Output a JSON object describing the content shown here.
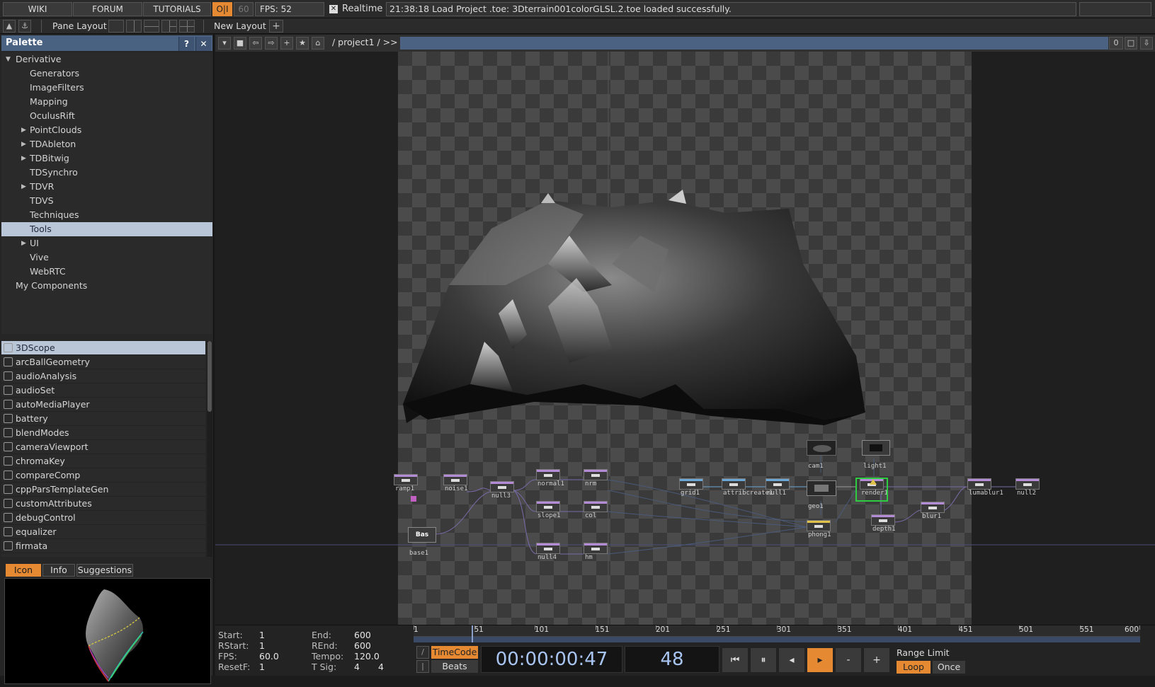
{
  "topbar": {
    "wiki": "WIKI",
    "forum": "FORUM",
    "tutorials": "TUTORIALS",
    "oi": "O|I",
    "sixty": "60",
    "fps": "FPS:",
    "fps_value": "52",
    "realtime_check": "✕",
    "realtime": "Realtime",
    "status": "21:38:18 Load Project .toe: 3Dterrain001colorGLSL.2.toe loaded successfully."
  },
  "toolbar2": {
    "pane_layout": "Pane Layout",
    "new_layout": "New Layout",
    "plus": "+"
  },
  "palette": {
    "title": "Palette",
    "help": "?",
    "close": "✕",
    "tree": [
      {
        "label": "Derivative",
        "level": 0,
        "arrow": "down"
      },
      {
        "label": "Generators",
        "level": 1,
        "arrow": ""
      },
      {
        "label": "ImageFilters",
        "level": 1,
        "arrow": ""
      },
      {
        "label": "Mapping",
        "level": 1,
        "arrow": ""
      },
      {
        "label": "OculusRift",
        "level": 1,
        "arrow": ""
      },
      {
        "label": "PointClouds",
        "level": 1,
        "arrow": "right"
      },
      {
        "label": "TDAbleton",
        "level": 1,
        "arrow": "right"
      },
      {
        "label": "TDBitwig",
        "level": 1,
        "arrow": "right"
      },
      {
        "label": "TDSynchro",
        "level": 1,
        "arrow": ""
      },
      {
        "label": "TDVR",
        "level": 1,
        "arrow": "right"
      },
      {
        "label": "TDVS",
        "level": 1,
        "arrow": ""
      },
      {
        "label": "Techniques",
        "level": 1,
        "arrow": ""
      },
      {
        "label": "Tools",
        "level": 1,
        "arrow": "",
        "selected": true
      },
      {
        "label": "UI",
        "level": 1,
        "arrow": "right"
      },
      {
        "label": "Vive",
        "level": 1,
        "arrow": ""
      },
      {
        "label": "WebRTC",
        "level": 1,
        "arrow": ""
      },
      {
        "label": "My Components",
        "level": 0,
        "arrow": ""
      }
    ],
    "components": [
      "3DScope",
      "arcBallGeometry",
      "audioAnalysis",
      "audioSet",
      "autoMediaPlayer",
      "battery",
      "blendModes",
      "cameraViewport",
      "chromaKey",
      "compareComp",
      "cppParsTemplateGen",
      "customAttributes",
      "debugControl",
      "equalizer",
      "firmata"
    ],
    "selected_component": "3DScope",
    "tabs": {
      "icon": "Icon",
      "info": "Info",
      "suggestions": "Suggestions"
    }
  },
  "network": {
    "path": "/ project1 / >>",
    "zero": "0",
    "nodes": [
      {
        "label": "ramp1",
        "color": "#b58ad6"
      },
      {
        "label": "noise1",
        "color": "#b58ad6"
      },
      {
        "label": "null3",
        "color": "#b58ad6"
      },
      {
        "label": "normal1",
        "color": "#b58ad6"
      },
      {
        "label": "nrm",
        "color": "#b58ad6"
      },
      {
        "label": "slope1",
        "color": "#b58ad6"
      },
      {
        "label": "col",
        "color": "#b58ad6"
      },
      {
        "label": "base1",
        "color": "#bbbbbb"
      },
      {
        "label": "null4",
        "color": "#b58ad6"
      },
      {
        "label": "hm",
        "color": "#b58ad6"
      },
      {
        "label": "grid1",
        "color": "#6aa7d6"
      },
      {
        "label": "attribcreate1",
        "color": "#6aa7d6"
      },
      {
        "label": "null1",
        "color": "#6aa7d6"
      },
      {
        "label": "cam1",
        "color": "#999999"
      },
      {
        "label": "light1",
        "color": "#999999"
      },
      {
        "label": "geo1",
        "color": "#999999"
      },
      {
        "label": "render1",
        "color": "#b58ad6"
      },
      {
        "label": "phong1",
        "color": "#e0c24a"
      },
      {
        "label": "depth1",
        "color": "#b58ad6"
      },
      {
        "label": "blur1",
        "color": "#b58ad6"
      },
      {
        "label": "lumablur1",
        "color": "#b58ad6"
      },
      {
        "label": "null2",
        "color": "#b58ad6"
      }
    ],
    "base_text": "Bas"
  },
  "timeline": {
    "start_label": "Start:",
    "start": "1",
    "rstart_label": "RStart:",
    "rstart": "1",
    "fps_label": "FPS:",
    "fps": "60.0",
    "resetf_label": "ResetF:",
    "resetf": "1",
    "end_label": "End:",
    "end": "600",
    "rend_label": "REnd:",
    "rend": "600",
    "tempo_label": "Tempo:",
    "tempo": "120.0",
    "tsig_label": "T Sig:",
    "tsig1": "4",
    "tsig2": "4",
    "ruler": [
      "1",
      "51",
      "101",
      "151",
      "201",
      "251",
      "301",
      "351",
      "401",
      "451",
      "501",
      "551",
      "600"
    ],
    "timecode_btn": "TimeCode",
    "beats_btn": "Beats",
    "timecode": "00:00:00:47",
    "frame": "48",
    "range_limit": "Range Limit",
    "loop": "Loop",
    "once": "Once",
    "minus": "-",
    "plus": "+",
    "progress": 0.08
  }
}
